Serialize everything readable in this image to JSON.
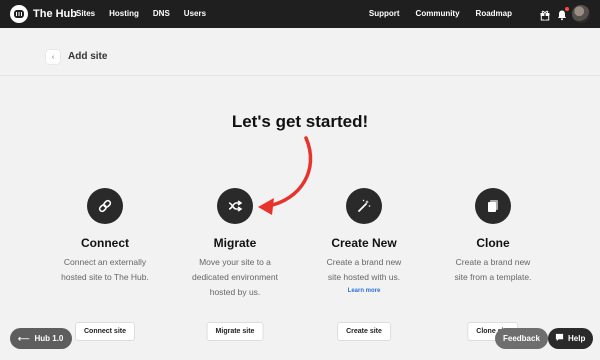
{
  "topbar": {
    "brand": "The Hub",
    "nav_left": [
      "Sites",
      "Hosting",
      "DNS",
      "Users"
    ],
    "nav_right": [
      "Support",
      "Community",
      "Roadmap"
    ],
    "icons": [
      "gift-icon",
      "bell-icon"
    ]
  },
  "header": {
    "title": "Add site"
  },
  "main": {
    "heading": "Let's get started!",
    "cards": [
      {
        "title": "Connect",
        "description": "Connect an externally hosted site to The Hub.",
        "button": "Connect site",
        "icon": "link-icon"
      },
      {
        "title": "Migrate",
        "description": "Move your site to a dedicated environment hosted by us.",
        "button": "Migrate site",
        "icon": "migrate-icon"
      },
      {
        "title": "Create New",
        "description": "Create a brand new site hosted with us.",
        "link": "Learn more",
        "button": "Create site",
        "icon": "magic-wand-icon"
      },
      {
        "title": "Clone",
        "description": "Create a brand new site from a template.",
        "button": "Clone site",
        "icon": "copy-icon"
      }
    ]
  },
  "footer": {
    "hub_version": "Hub 1.0",
    "feedback": "Feedback",
    "help": "Help"
  },
  "colors": {
    "topbar_bg": "#1f1f1f",
    "page_bg": "#f2f2f2",
    "accent_red": "#e8332c",
    "link_blue": "#2f6fd6"
  }
}
